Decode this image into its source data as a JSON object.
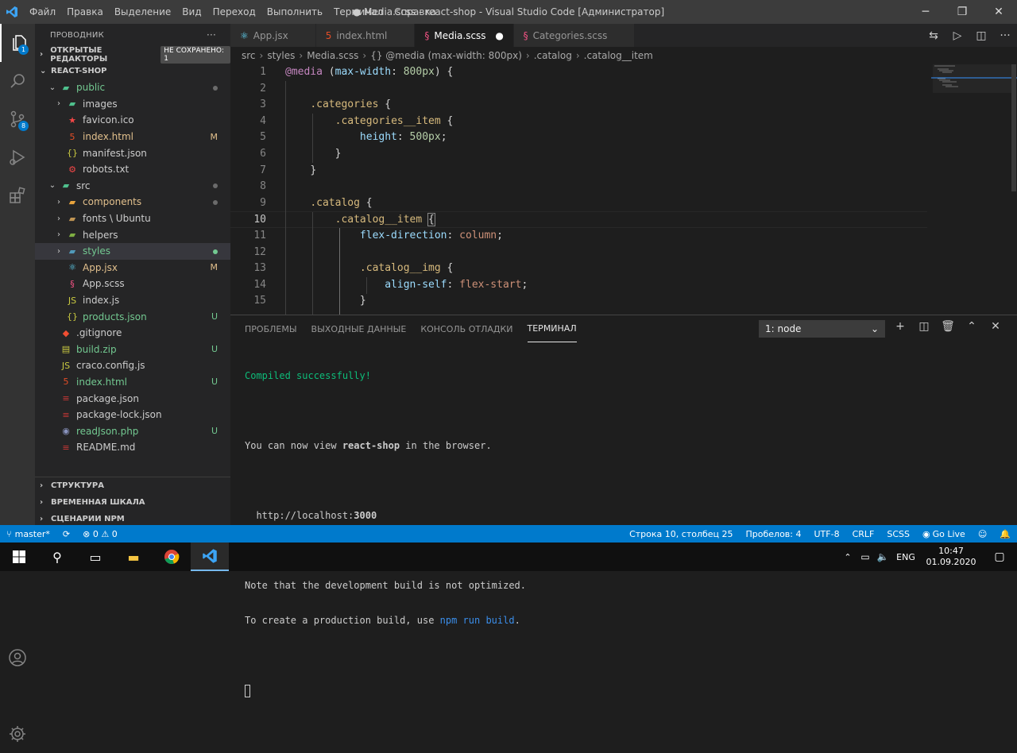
{
  "titlebar": {
    "menu": [
      "Файл",
      "Правка",
      "Выделение",
      "Вид",
      "Переход",
      "Выполнить",
      "Терминал",
      "Справка"
    ],
    "title": "● Media.scss - react-shop - Visual Studio Code [Администратор]"
  },
  "activity": {
    "explorer_badge": "1",
    "scm_badge": "8"
  },
  "sidebar": {
    "header": "ПРОВОДНИК",
    "more": "···",
    "open_editors": "ОТКРЫТЫЕ РЕДАКТОРЫ",
    "unsaved_badge": "НЕ СОХРАНЕНО: 1",
    "project": "REACT-SHOP",
    "tree": [
      {
        "label": "public",
        "indent": 1,
        "chev": "⌄",
        "icon": "▰",
        "icon_color": "#4fc08d",
        "status": "dot",
        "color": "#73c991"
      },
      {
        "label": "images",
        "indent": 2,
        "chev": "›",
        "icon": "▰",
        "icon_color": "#4fc08d",
        "status": "",
        "color": "#cccccc"
      },
      {
        "label": "favicon.ico",
        "indent": 2,
        "chev": "",
        "icon": "★",
        "icon_color": "#f44747",
        "status": "",
        "color": "#cccccc"
      },
      {
        "label": "index.html",
        "indent": 2,
        "chev": "",
        "icon": "5",
        "icon_color": "#e44d26",
        "status": "M",
        "color": "#e2c08d"
      },
      {
        "label": "manifest.json",
        "indent": 2,
        "chev": "",
        "icon": "{}",
        "icon_color": "#cbcb41",
        "status": "",
        "color": "#cccccc"
      },
      {
        "label": "robots.txt",
        "indent": 2,
        "chev": "",
        "icon": "⚙",
        "icon_color": "#f44747",
        "status": "",
        "color": "#cccccc"
      },
      {
        "label": "src",
        "indent": 1,
        "chev": "⌄",
        "icon": "▰",
        "icon_color": "#4fc08d",
        "status": "dot",
        "color": "#cccccc"
      },
      {
        "label": "components",
        "indent": 2,
        "chev": "›",
        "icon": "▰",
        "icon_color": "#e8a33d",
        "status": "dot",
        "color": "#e2c08d"
      },
      {
        "label": "fonts \\ Ubuntu",
        "indent": 2,
        "chev": "›",
        "icon": "▰",
        "icon_color": "#c09553",
        "status": "",
        "color": "#cccccc"
      },
      {
        "label": "helpers",
        "indent": 2,
        "chev": "›",
        "icon": "▰",
        "icon_color": "#7fae42",
        "status": "",
        "color": "#cccccc"
      },
      {
        "label": "styles",
        "indent": 2,
        "chev": "›",
        "icon": "▰",
        "icon_color": "#519aba",
        "status": "greendot",
        "color": "#73c991",
        "selected": true
      },
      {
        "label": "App.jsx",
        "indent": 2,
        "chev": "",
        "icon": "⚛",
        "icon_color": "#61dafb",
        "status": "M",
        "color": "#e2c08d"
      },
      {
        "label": "App.scss",
        "indent": 2,
        "chev": "",
        "icon": "§",
        "icon_color": "#f55385",
        "status": "",
        "color": "#cccccc"
      },
      {
        "label": "index.js",
        "indent": 2,
        "chev": "",
        "icon": "JS",
        "icon_color": "#cbcb41",
        "status": "",
        "color": "#cccccc"
      },
      {
        "label": "products.json",
        "indent": 2,
        "chev": "",
        "icon": "{}",
        "icon_color": "#cbcb41",
        "status": "U",
        "color": "#73c991"
      },
      {
        "label": ".gitignore",
        "indent": 1,
        "chev": "",
        "icon": "◆",
        "icon_color": "#f14e32",
        "status": "",
        "color": "#cccccc"
      },
      {
        "label": "build.zip",
        "indent": 1,
        "chev": "",
        "icon": "▤",
        "icon_color": "#cbcb41",
        "status": "U",
        "color": "#73c991"
      },
      {
        "label": "craco.config.js",
        "indent": 1,
        "chev": "",
        "icon": "JS",
        "icon_color": "#cbcb41",
        "status": "",
        "color": "#cccccc"
      },
      {
        "label": "index.html",
        "indent": 1,
        "chev": "",
        "icon": "5",
        "icon_color": "#e44d26",
        "status": "U",
        "color": "#73c991"
      },
      {
        "label": "package.json",
        "indent": 1,
        "chev": "",
        "icon": "≡",
        "icon_color": "#cb3837",
        "status": "",
        "color": "#cccccc"
      },
      {
        "label": "package-lock.json",
        "indent": 1,
        "chev": "",
        "icon": "≡",
        "icon_color": "#cb3837",
        "status": "",
        "color": "#cccccc"
      },
      {
        "label": "readJson.php",
        "indent": 1,
        "chev": "",
        "icon": "◉",
        "icon_color": "#8993be",
        "status": "U",
        "color": "#73c991"
      },
      {
        "label": "README.md",
        "indent": 1,
        "chev": "",
        "icon": "≡",
        "icon_color": "#cb3837",
        "status": "",
        "color": "#cccccc"
      }
    ],
    "bottom_sections": [
      "СТРУКТУРА",
      "ВРЕМЕННАЯ ШКАЛА",
      "СЦЕНАРИИ NPM"
    ]
  },
  "tabs": [
    {
      "label": "App.jsx",
      "icon": "⚛",
      "icon_color": "#61dafb",
      "active": false,
      "close": ""
    },
    {
      "label": "index.html",
      "icon": "5",
      "icon_color": "#e44d26",
      "active": false,
      "close": ""
    },
    {
      "label": "Media.scss",
      "icon": "§",
      "icon_color": "#f55385",
      "active": true,
      "close": "●"
    },
    {
      "label": "Categories.scss",
      "icon": "§",
      "icon_color": "#f55385",
      "active": false,
      "close": ""
    }
  ],
  "breadcrumb": [
    "src",
    "styles",
    "Media.scss",
    "{} @media (max-width: 800px)",
    ".catalog",
    ".catalog__item"
  ],
  "code_lines": [
    {
      "n": "1",
      "html": "<span class='at'>@media</span> <span class='pun'>(</span><span class='prop'>max-width</span><span class='pun'>: </span><span class='num'>800px</span><span class='pun'>) {</span>"
    },
    {
      "n": "2",
      "html": ""
    },
    {
      "n": "3",
      "html": "    <span class='sel'>.categories</span> <span class='pun'>{</span>"
    },
    {
      "n": "4",
      "html": "        <span class='sel'>.categories__item</span> <span class='pun'>{</span>"
    },
    {
      "n": "5",
      "html": "            <span class='prop'>height</span><span class='pun'>: </span><span class='num'>500px</span><span class='pun'>;</span>"
    },
    {
      "n": "6",
      "html": "        <span class='pun'>}</span>"
    },
    {
      "n": "7",
      "html": "    <span class='pun'>}</span>"
    },
    {
      "n": "8",
      "html": ""
    },
    {
      "n": "9",
      "html": "    <span class='sel'>.catalog</span> <span class='pun'>{</span>"
    },
    {
      "n": "10",
      "html": "        <span class='sel'>.catalog__item</span> <span class='pun' style='outline:1px solid #888'>{</span>"
    },
    {
      "n": "11",
      "html": "            <span class='prop'>flex-direction</span><span class='pun'>: </span><span class='val'>column</span><span class='pun'>;</span>"
    },
    {
      "n": "12",
      "html": ""
    },
    {
      "n": "13",
      "html": "            <span class='sel'>.catalog__img</span> <span class='pun'>{</span>"
    },
    {
      "n": "14",
      "html": "                <span class='prop'>align-self</span><span class='pun'>: </span><span class='val'>flex-start</span><span class='pun'>;</span>"
    },
    {
      "n": "15",
      "html": "            <span class='pun'>}</span>"
    }
  ],
  "current_line": "10",
  "panel": {
    "tabs": [
      "ПРОБЛЕМЫ",
      "ВЫХОДНЫЕ ДАННЫЕ",
      "КОНСОЛЬ ОТЛАДКИ",
      "ТЕРМИНАЛ"
    ],
    "active_tab": "ТЕРМИНАЛ",
    "terminal_select": "1: node",
    "terminal": {
      "l1": "Compiled successfully!",
      "l2a": "You can now view ",
      "l2b": "react-shop",
      "l2c": " in the browser.",
      "l3a": "  http://localhost:",
      "l3b": "3000",
      "l4": "Note that the development build is not optimized.",
      "l5a": "To create a production build, use ",
      "l5b": "npm run build",
      "l5c": "."
    }
  },
  "statusbar": {
    "branch": "master*",
    "errors": "0",
    "warnings": "0",
    "position": "Строка 10, столбец 25",
    "spaces": "Пробелов: 4",
    "encoding": "UTF-8",
    "eol": "CRLF",
    "language": "SCSS",
    "golive": "Go Live"
  },
  "taskbar": {
    "lang": "ENG",
    "time": "10:47",
    "date": "01.09.2020"
  }
}
